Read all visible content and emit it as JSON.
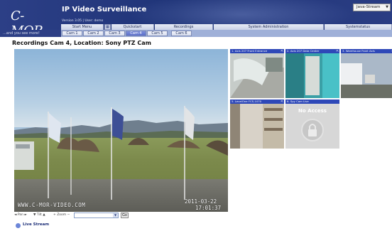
{
  "header": {
    "logo": "C-MOR",
    "slogan": "...and you see more!",
    "title": "IP Video Surveillance",
    "version": "Version 3.05 | User: demo",
    "stream_select": "Java-Stream"
  },
  "main_menu": [
    "Start Menu",
    "Quickstart",
    "Recordings",
    "System Administration",
    "Systemstatus"
  ],
  "cam_tabs": [
    "Cam 1",
    "Cam 2",
    "Cam 3",
    "Cam 4",
    "Cam 5",
    "Cam 6"
  ],
  "active_tab": "Cam 4",
  "page_heading": "Recordings Cam 4, Location: Sony PTZ Cam",
  "video": {
    "watermark": "WWW.C-MOR-VIDEO.COM",
    "date": "2011-03-22",
    "time": "17:01:37"
  },
  "controls": {
    "pan": "◄ Pan ►",
    "tilt": "▼ Tilt ▲",
    "zoom": "+ Zoom −",
    "go": "Go"
  },
  "live_stream": "Live Stream",
  "thumbnails": [
    "1. Axis 207 Front Entrance",
    "2. Axis 207 Data Center",
    "3. Warehouse Front Axis",
    "5. LevelOne FCS-1070",
    "6. Spy Cam Live"
  ],
  "no_access": "No Access"
}
